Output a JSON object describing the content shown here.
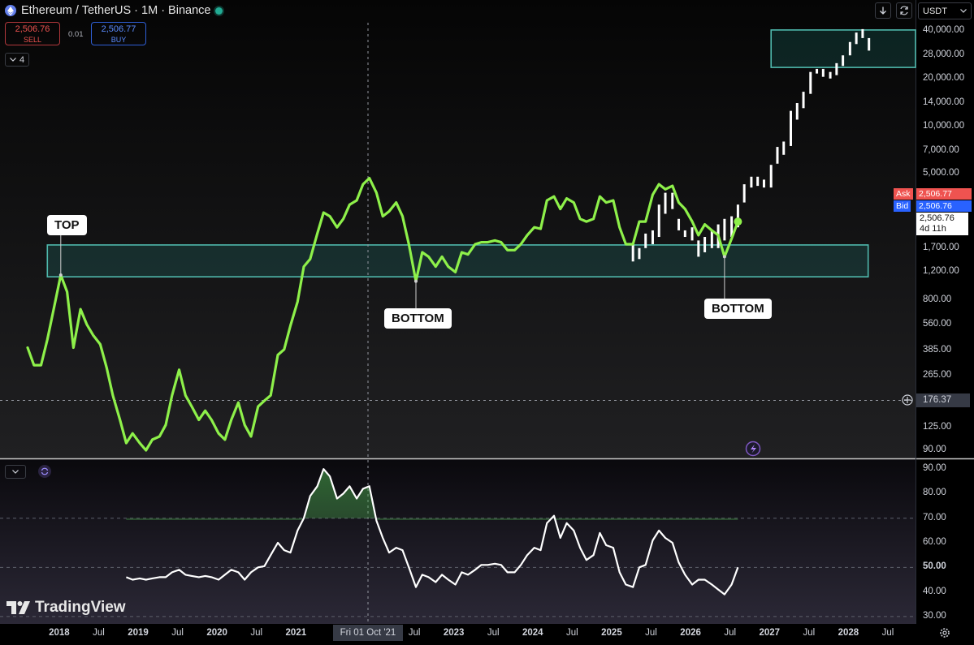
{
  "header": {
    "title": "Ethereum / TetherUS · 1M · Binance",
    "sell_price": "2,506.76",
    "sell_label": "SELL",
    "spread": "0.01",
    "buy_price": "2,506.77",
    "buy_label": "BUY",
    "indicator_count": "4",
    "currency": "USDT"
  },
  "price_tags": {
    "ask_label": "Ask",
    "ask_value": "2,506.77",
    "bid_label": "Bid",
    "bid_value": "2,506.76",
    "last_value": "2,506.76",
    "countdown": "4d 11h",
    "crosshair_price": "176.37",
    "crosshair_date": "Fri 01 Oct '21"
  },
  "annotations": {
    "top": "TOP",
    "bottom1": "BOTTOM",
    "bottom2": "BOTTOM"
  },
  "logo": "TradingView",
  "colors": {
    "price_line": "#8ef04a",
    "zone_border": "#4fb9ad",
    "zone_fill": "rgba(38,166,154,0.18)",
    "ask": "#ef5350",
    "bid": "#2962ff",
    "rsi_line": "#ffffff"
  },
  "chart_data": [
    {
      "type": "line",
      "scale": "log",
      "y_ticks": [
        "40,000.00",
        "28,000.00",
        "20,000.00",
        "14,000.00",
        "10,000.00",
        "7,000.00",
        "5,000.00",
        "1,700.00",
        "1,200.00",
        "800.00",
        "560.00",
        "385.00",
        "265.00",
        "125.00",
        "90.00"
      ],
      "y_tick_values": [
        40000,
        28000,
        20000,
        14000,
        10000,
        7000,
        5000,
        1700,
        1200,
        800,
        560,
        385,
        265,
        125,
        90
      ],
      "ylim": [
        80,
        45000
      ],
      "x_ticks": [
        "2018",
        "Jul",
        "2019",
        "Jul",
        "2020",
        "Jul",
        "2021",
        "Jul",
        "2023",
        "Jul",
        "2024",
        "Jul",
        "2025",
        "Jul",
        "2026",
        "Jul",
        "2027",
        "Jul",
        "2028",
        "Jul"
      ],
      "x_tick_values": [
        2018.0,
        2018.5,
        2019.0,
        2019.5,
        2020.0,
        2020.5,
        2021.0,
        2022.5,
        2023.0,
        2023.5,
        2024.0,
        2024.5,
        2025.0,
        2025.5,
        2026.0,
        2026.5,
        2027.0,
        2027.5,
        2028.0,
        2028.5
      ],
      "xlim": [
        2017.25,
        2028.85
      ],
      "series": [
        {
          "values": [
            [
              2017.6,
              400
            ],
            [
              2017.68,
              310
            ],
            [
              2017.77,
              310
            ],
            [
              2017.85,
              450
            ],
            [
              2017.93,
              700
            ],
            [
              2018.02,
              1150
            ],
            [
              2018.1,
              900
            ],
            [
              2018.18,
              400
            ],
            [
              2018.27,
              700
            ],
            [
              2018.35,
              560
            ],
            [
              2018.43,
              480
            ],
            [
              2018.52,
              420
            ],
            [
              2018.6,
              300
            ],
            [
              2018.68,
              200
            ],
            [
              2018.77,
              140
            ],
            [
              2018.85,
              100
            ],
            [
              2018.93,
              115
            ],
            [
              2019.02,
              100
            ],
            [
              2019.1,
              90
            ],
            [
              2019.18,
              105
            ],
            [
              2019.27,
              110
            ],
            [
              2019.35,
              130
            ],
            [
              2019.43,
              200
            ],
            [
              2019.52,
              290
            ],
            [
              2019.6,
              200
            ],
            [
              2019.68,
              170
            ],
            [
              2019.77,
              140
            ],
            [
              2019.85,
              160
            ],
            [
              2019.93,
              140
            ],
            [
              2020.02,
              115
            ],
            [
              2020.1,
              105
            ],
            [
              2020.18,
              140
            ],
            [
              2020.27,
              180
            ],
            [
              2020.35,
              130
            ],
            [
              2020.43,
              110
            ],
            [
              2020.52,
              170
            ],
            [
              2020.6,
              185
            ],
            [
              2020.68,
              200
            ],
            [
              2020.77,
              360
            ],
            [
              2020.85,
              390
            ],
            [
              2020.93,
              550
            ],
            [
              2021.02,
              780
            ],
            [
              2021.1,
              1300
            ],
            [
              2021.18,
              1450
            ],
            [
              2021.27,
              2100
            ],
            [
              2021.35,
              2850
            ],
            [
              2021.43,
              2700
            ],
            [
              2021.52,
              2300
            ],
            [
              2021.6,
              2600
            ],
            [
              2021.68,
              3200
            ],
            [
              2021.77,
              3400
            ],
            [
              2021.85,
              4300
            ],
            [
              2021.93,
              4700
            ],
            [
              2022.02,
              3800
            ],
            [
              2022.1,
              2700
            ],
            [
              2022.18,
              2900
            ],
            [
              2022.27,
              3300
            ],
            [
              2022.35,
              2700
            ],
            [
              2022.43,
              1800
            ],
            [
              2022.52,
              1050
            ],
            [
              2022.6,
              1600
            ],
            [
              2022.68,
              1500
            ],
            [
              2022.77,
              1300
            ],
            [
              2022.85,
              1500
            ],
            [
              2022.93,
              1300
            ],
            [
              2023.02,
              1200
            ],
            [
              2023.1,
              1600
            ],
            [
              2023.18,
              1550
            ],
            [
              2023.27,
              1800
            ],
            [
              2023.35,
              1850
            ],
            [
              2023.43,
              1850
            ],
            [
              2023.52,
              1900
            ],
            [
              2023.6,
              1850
            ],
            [
              2023.68,
              1650
            ],
            [
              2023.77,
              1650
            ],
            [
              2023.85,
              1800
            ],
            [
              2023.93,
              2050
            ],
            [
              2024.02,
              2300
            ],
            [
              2024.1,
              2250
            ],
            [
              2024.18,
              3400
            ],
            [
              2024.27,
              3600
            ],
            [
              2024.35,
              3000
            ],
            [
              2024.43,
              3500
            ],
            [
              2024.52,
              3300
            ],
            [
              2024.6,
              2600
            ],
            [
              2024.68,
              2500
            ],
            [
              2024.77,
              2600
            ],
            [
              2024.85,
              3600
            ],
            [
              2024.93,
              3300
            ],
            [
              2025.02,
              3400
            ],
            [
              2025.1,
              2300
            ],
            [
              2025.18,
              1800
            ],
            [
              2025.27,
              1800
            ],
            [
              2025.35,
              2500
            ],
            [
              2025.43,
              2500
            ],
            [
              2025.52,
              3700
            ],
            [
              2025.6,
              4300
            ],
            [
              2025.68,
              4000
            ],
            [
              2025.77,
              4200
            ],
            [
              2025.85,
              3300
            ],
            [
              2025.93,
              3000
            ],
            [
              2026.02,
              2500
            ],
            [
              2026.1,
              2050
            ],
            [
              2026.18,
              2400
            ],
            [
              2026.27,
              2200
            ],
            [
              2026.35,
              2050
            ],
            [
              2026.43,
              1500
            ],
            [
              2026.52,
              1950
            ],
            [
              2026.6,
              2500
            ]
          ]
        }
      ],
      "candle_projection": [
        [
          2025.27,
          1400,
          1800
        ],
        [
          2025.35,
          1450,
          1700
        ],
        [
          2025.43,
          1700,
          2100
        ],
        [
          2025.52,
          1800,
          2200
        ],
        [
          2025.6,
          2000,
          3200
        ],
        [
          2025.68,
          2800,
          3800
        ],
        [
          2025.77,
          3000,
          3800
        ],
        [
          2025.85,
          2200,
          2600
        ],
        [
          2025.93,
          2000,
          2200
        ],
        [
          2026.02,
          1900,
          2300
        ],
        [
          2026.1,
          1500,
          1900
        ],
        [
          2026.18,
          1600,
          2000
        ],
        [
          2026.27,
          1700,
          2200
        ],
        [
          2026.35,
          1700,
          2400
        ],
        [
          2026.43,
          1900,
          2600
        ],
        [
          2026.52,
          2000,
          2700
        ],
        [
          2026.6,
          2300,
          3200
        ],
        [
          2026.68,
          3300,
          4300
        ],
        [
          2026.77,
          4100,
          4800
        ],
        [
          2026.85,
          4200,
          4800
        ],
        [
          2026.93,
          4100,
          4600
        ],
        [
          2027.02,
          4100,
          5700
        ],
        [
          2027.1,
          5800,
          7400
        ],
        [
          2027.18,
          6600,
          8000
        ],
        [
          2027.27,
          7500,
          12500
        ],
        [
          2027.35,
          11000,
          14000
        ],
        [
          2027.43,
          13000,
          16500
        ],
        [
          2027.52,
          16000,
          22000
        ],
        [
          2027.6,
          21500,
          23000
        ],
        [
          2027.68,
          20500,
          23000
        ],
        [
          2027.77,
          20000,
          22000
        ],
        [
          2027.85,
          21000,
          25000
        ],
        [
          2027.93,
          24000,
          28000
        ],
        [
          2028.02,
          28000,
          34000
        ],
        [
          2028.1,
          33000,
          39000
        ],
        [
          2028.18,
          36000,
          41000
        ],
        [
          2028.26,
          30000,
          36000
        ]
      ],
      "zones": [
        {
          "x0": 2027.02,
          "x1": 2028.85,
          "y0": 23500,
          "y1": 40500
        },
        {
          "x0": 2017.85,
          "x1": 2028.25,
          "y0": 1120,
          "y1": 1780
        }
      ]
    },
    {
      "type": "line",
      "y_ticks": [
        "90.00",
        "80.00",
        "70.00",
        "60.00",
        "50.00",
        "40.00",
        "30.00"
      ],
      "y_tick_values": [
        90,
        80,
        70,
        60,
        50,
        40,
        30
      ],
      "ylim": [
        27,
        94
      ],
      "levels": [
        70,
        50,
        30
      ],
      "series": [
        {
          "values": [
            [
              2018.85,
              46
            ],
            [
              2018.93,
              45
            ],
            [
              2019.02,
              45.5
            ],
            [
              2019.1,
              45
            ],
            [
              2019.18,
              45.5
            ],
            [
              2019.27,
              46
            ],
            [
              2019.35,
              46
            ],
            [
              2019.43,
              48
            ],
            [
              2019.52,
              49
            ],
            [
              2019.6,
              47
            ],
            [
              2019.68,
              46.5
            ],
            [
              2019.77,
              46
            ],
            [
              2019.85,
              46.5
            ],
            [
              2019.93,
              46
            ],
            [
              2020.02,
              45
            ],
            [
              2020.1,
              47
            ],
            [
              2020.18,
              49
            ],
            [
              2020.27,
              48
            ],
            [
              2020.35,
              45
            ],
            [
              2020.43,
              48
            ],
            [
              2020.52,
              50
            ],
            [
              2020.6,
              50.5
            ],
            [
              2020.68,
              55
            ],
            [
              2020.77,
              60
            ],
            [
              2020.85,
              57
            ],
            [
              2020.93,
              56
            ],
            [
              2021.02,
              65
            ],
            [
              2021.1,
              70
            ],
            [
              2021.18,
              79
            ],
            [
              2021.27,
              83
            ],
            [
              2021.35,
              90
            ],
            [
              2021.43,
              87
            ],
            [
              2021.52,
              78
            ],
            [
              2021.6,
              80
            ],
            [
              2021.68,
              83
            ],
            [
              2021.77,
              78
            ],
            [
              2021.85,
              82
            ],
            [
              2021.93,
              83
            ],
            [
              2022.02,
              69
            ],
            [
              2022.1,
              62
            ],
            [
              2022.18,
              56
            ],
            [
              2022.27,
              58
            ],
            [
              2022.35,
              57
            ],
            [
              2022.43,
              50
            ],
            [
              2022.52,
              42
            ],
            [
              2022.6,
              47
            ],
            [
              2022.68,
              46
            ],
            [
              2022.77,
              44
            ],
            [
              2022.85,
              47
            ],
            [
              2022.93,
              45
            ],
            [
              2023.02,
              43
            ],
            [
              2023.1,
              48
            ],
            [
              2023.18,
              47
            ],
            [
              2023.27,
              49
            ],
            [
              2023.35,
              51
            ],
            [
              2023.43,
              51
            ],
            [
              2023.52,
              51.5
            ],
            [
              2023.6,
              51
            ],
            [
              2023.68,
              48
            ],
            [
              2023.77,
              48
            ],
            [
              2023.85,
              51
            ],
            [
              2023.93,
              55
            ],
            [
              2024.02,
              58
            ],
            [
              2024.1,
              57
            ],
            [
              2024.18,
              68
            ],
            [
              2024.27,
              71
            ],
            [
              2024.35,
              62
            ],
            [
              2024.43,
              68
            ],
            [
              2024.52,
              65
            ],
            [
              2024.6,
              58
            ],
            [
              2024.68,
              53
            ],
            [
              2024.77,
              55
            ],
            [
              2024.85,
              64
            ],
            [
              2024.93,
              59
            ],
            [
              2025.02,
              58
            ],
            [
              2025.1,
              48
            ],
            [
              2025.18,
              43
            ],
            [
              2025.27,
              42
            ],
            [
              2025.35,
              50
            ],
            [
              2025.43,
              51
            ],
            [
              2025.52,
              61
            ],
            [
              2025.6,
              65
            ],
            [
              2025.68,
              62
            ],
            [
              2025.77,
              60
            ],
            [
              2025.85,
              52
            ],
            [
              2025.93,
              47
            ],
            [
              2026.02,
              43
            ],
            [
              2026.1,
              45
            ],
            [
              2026.18,
              45
            ],
            [
              2026.27,
              43
            ],
            [
              2026.35,
              41
            ],
            [
              2026.43,
              39
            ],
            [
              2026.52,
              43
            ],
            [
              2026.6,
              50
            ]
          ]
        }
      ]
    }
  ]
}
